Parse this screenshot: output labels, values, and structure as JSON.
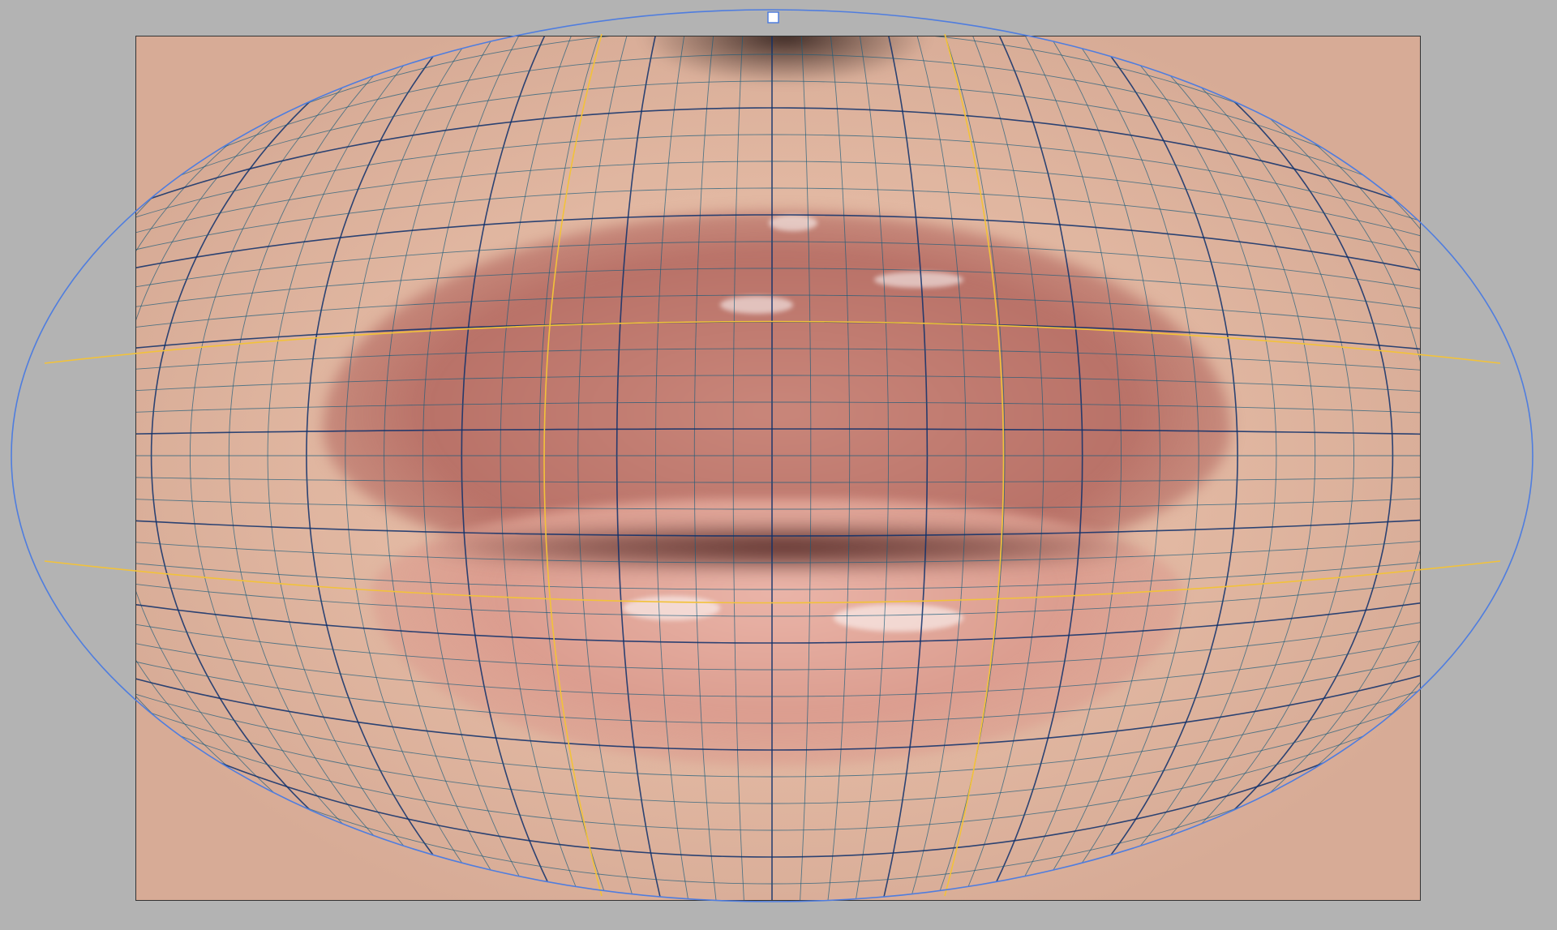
{
  "app": {
    "tool": "warp-mesh",
    "mode": "spherize-envelope"
  },
  "document": {
    "subject": "",
    "has_grid": true,
    "grid_columns": 40,
    "grid_rows": 34
  },
  "colors": {
    "workspace_bg": "#b3b3b3",
    "envelope_outline": "#4f7ddf",
    "guide_lines": "#f2c23a",
    "mesh_lines": "#1a5b7a",
    "mesh_major_lines": "#0d2f6b",
    "handle_fill": "#ffffff",
    "handle_stroke": "#4f7ddf"
  },
  "icons": {
    "top_handle": "square-control-handle-icon"
  }
}
